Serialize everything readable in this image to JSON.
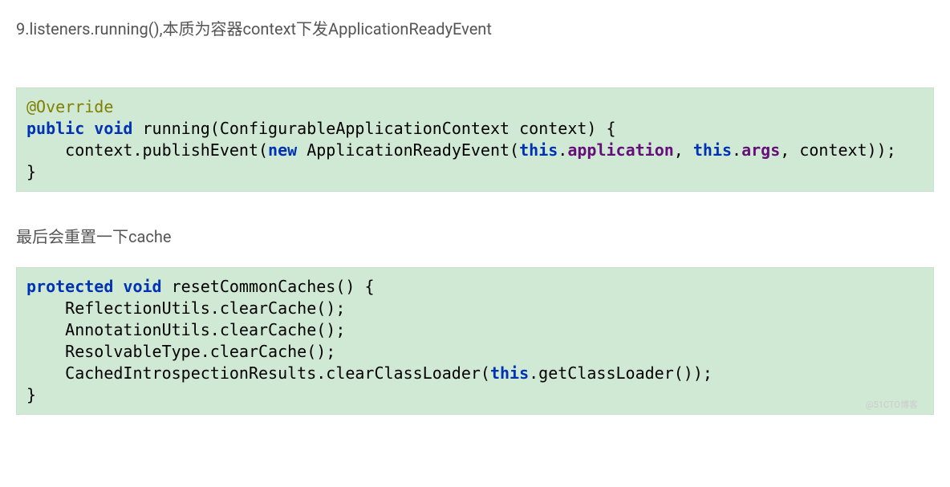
{
  "heading1": "9.listeners.running(),本质为容器context下发ApplicationReadyEvent",
  "code1": {
    "ann": "@Override",
    "kw_public": "public",
    "kw_void": "void",
    "fn": " running(ConfigurableApplicationContext context) {",
    "indent": "    context.publishEvent(",
    "kw_new": "new",
    "after_new": " ApplicationReadyEvent(",
    "kw_this1": "this",
    "dot_app": ".",
    "fld_app": "application",
    "sep1": ", ",
    "kw_this2": "this",
    "dot_args": ".",
    "fld_args": "args",
    "tail": ", context));",
    "close": "}"
  },
  "heading2": "最后会重置一下cache",
  "code2": {
    "kw_protected": "protected",
    "kw_void": "void",
    "sig": " resetCommonCaches() {",
    "l1": "    ReflectionUtils.clearCache();",
    "l2": "    AnnotationUtils.clearCache();",
    "l3": "    ResolvableType.clearCache();",
    "l4a": "    CachedIntrospectionResults.clearClassLoader(",
    "kw_this": "this",
    "l4b": ".getClassLoader());",
    "close": "}"
  },
  "watermark": "@51CTO博客"
}
